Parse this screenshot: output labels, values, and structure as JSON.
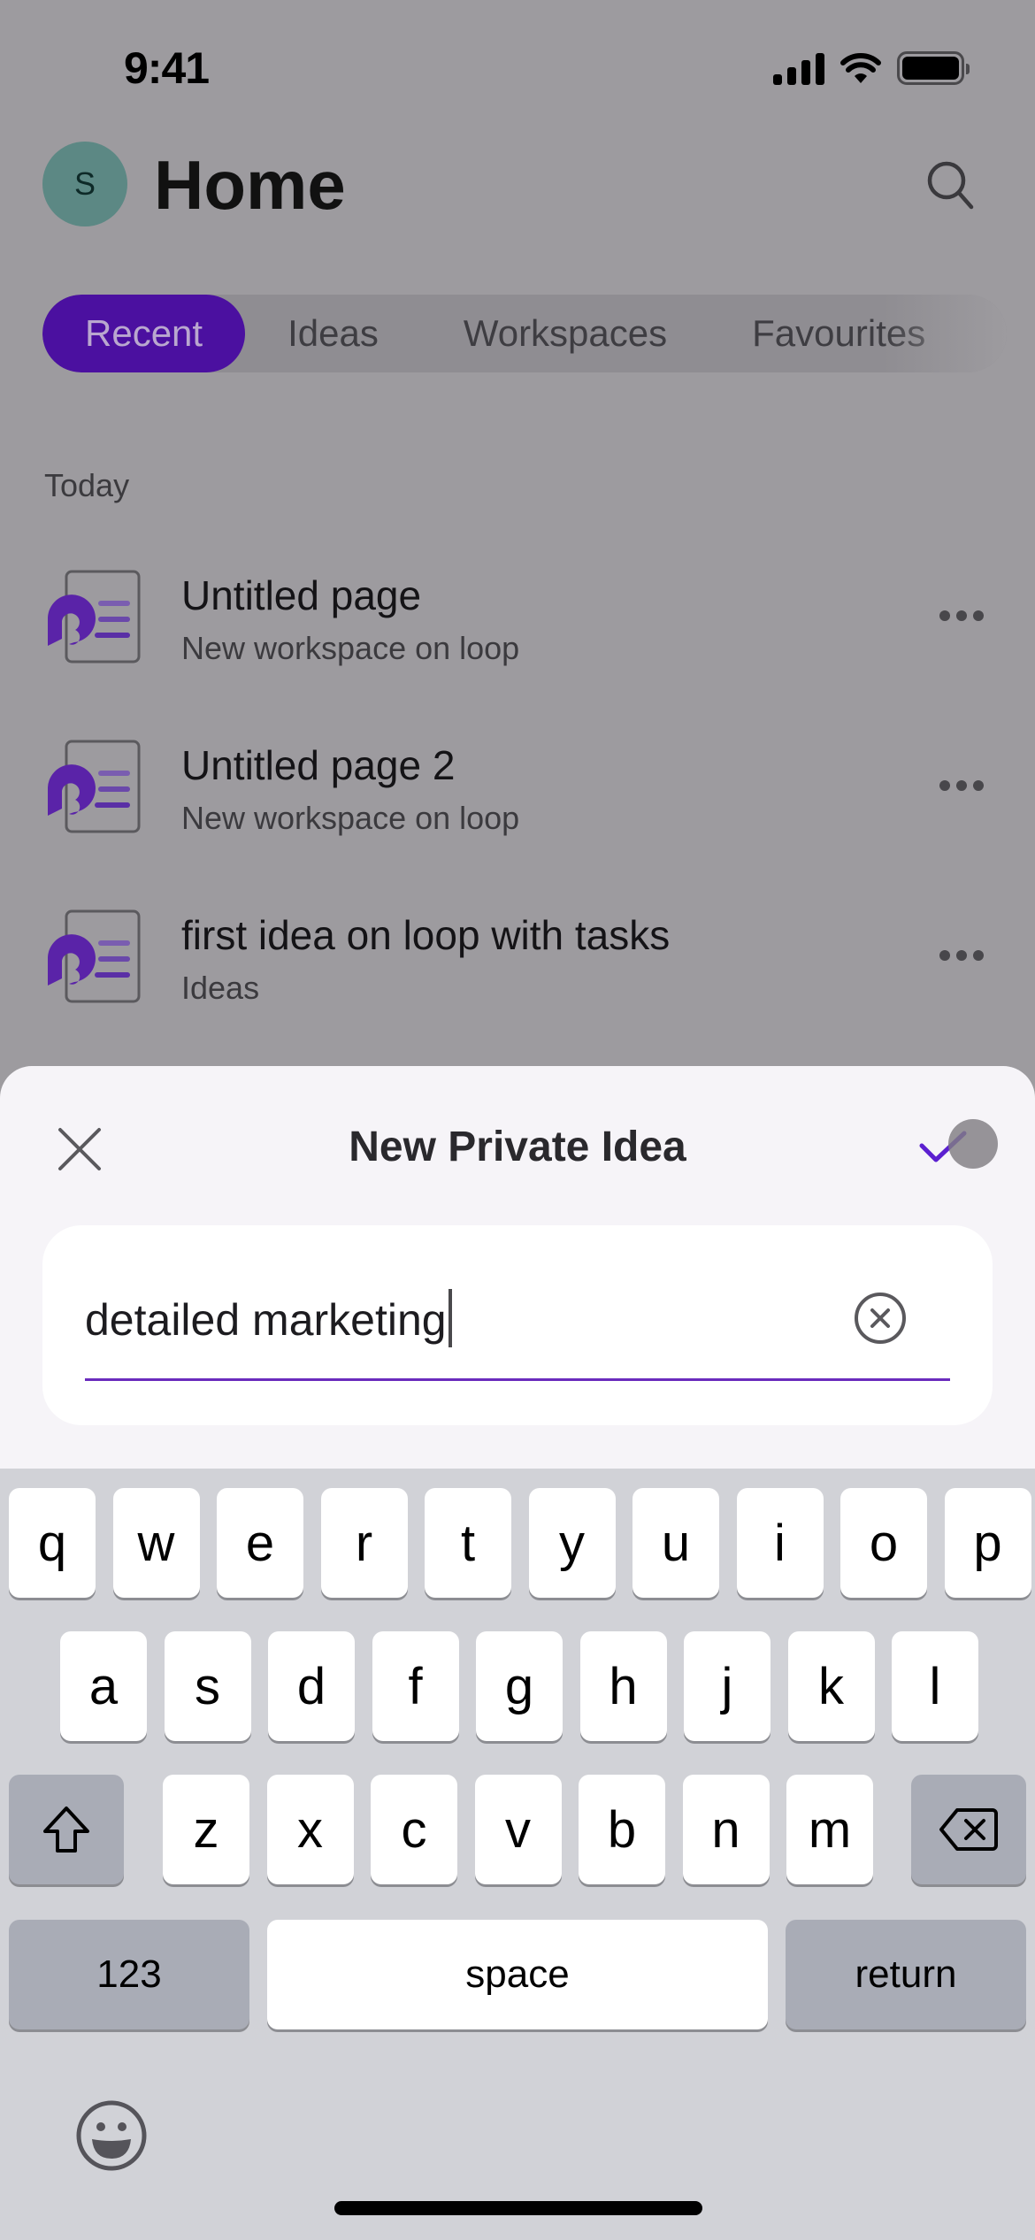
{
  "status_bar": {
    "time": "9:41"
  },
  "header": {
    "avatar_initial": "S",
    "title": "Home",
    "search_label": "Search"
  },
  "tabs": [
    {
      "label": "Recent",
      "active": true
    },
    {
      "label": "Ideas",
      "active": false
    },
    {
      "label": "Workspaces",
      "active": false
    },
    {
      "label": "Favourites",
      "active": false
    }
  ],
  "section": {
    "label": "Today"
  },
  "items": [
    {
      "title": "Untitled page",
      "subtitle": "New workspace on loop"
    },
    {
      "title": "Untitled page 2",
      "subtitle": "New workspace on loop"
    },
    {
      "title": "first idea on loop with tasks",
      "subtitle": "Ideas"
    }
  ],
  "sheet": {
    "title": "New Private Idea",
    "input_value": "detailed marketing",
    "close_label": "Close",
    "confirm_label": "Confirm"
  },
  "keyboard": {
    "row1": [
      "q",
      "w",
      "e",
      "r",
      "t",
      "y",
      "u",
      "i",
      "o",
      "p"
    ],
    "row2": [
      "a",
      "s",
      "d",
      "f",
      "g",
      "h",
      "j",
      "k",
      "l"
    ],
    "row3": [
      "z",
      "x",
      "c",
      "v",
      "b",
      "n",
      "m"
    ],
    "numbers_label": "123",
    "space_label": "space",
    "return_label": "return"
  },
  "colors": {
    "accent": "#4b10a0",
    "underline": "#6a2bbd",
    "avatar": "#5c8884",
    "overlay_bg": "#9d9b9f",
    "sheet_bg": "#f6f4f8",
    "keyboard_bg": "#d1d2d7"
  }
}
